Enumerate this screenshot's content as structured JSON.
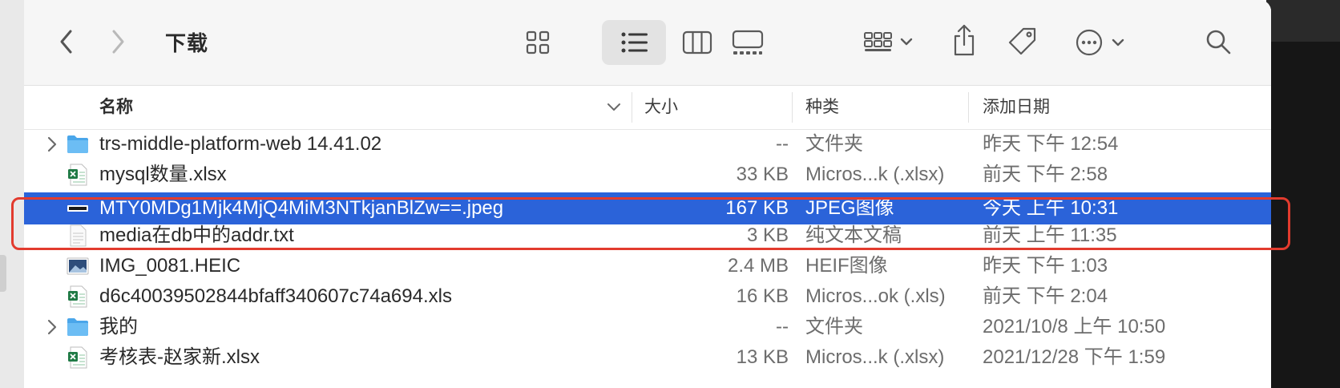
{
  "window": {
    "title": "下载",
    "toolbar_icons": [
      "chevron-left-icon",
      "chevron-right-icon",
      "grid-view-icon",
      "list-view-icon",
      "column-view-icon",
      "gallery-view-icon",
      "group-icon",
      "share-icon",
      "tag-icon",
      "more-icon",
      "search-icon"
    ]
  },
  "columns": {
    "name": "名称",
    "size": "大小",
    "kind": "种类",
    "date_added": "添加日期"
  },
  "files": [
    {
      "name": "trs-middle-platform-web 14.41.02",
      "size": "--",
      "kind": "文件夹",
      "date": "昨天 下午 12:54",
      "icon": "folder-icon",
      "expandable": true,
      "selected": false
    },
    {
      "name": "mysql数量.xlsx",
      "size": "33 KB",
      "kind": "Micros...k (.xlsx)",
      "date": "前天 下午 2:58",
      "icon": "excel-icon",
      "expandable": false,
      "selected": false
    },
    {
      "name": "MTY0MDg1Mjk4MjQ4MiM3NTkjanBlZw==.jpeg",
      "size": "167 KB",
      "kind": "JPEG图像",
      "date": "今天 上午 10:31",
      "icon": "image-icon",
      "expandable": false,
      "selected": true
    },
    {
      "name": "media在db中的addr.txt",
      "size": "3 KB",
      "kind": "纯文本文稿",
      "date": "前天 上午 11:35",
      "icon": "text-file-icon",
      "expandable": false,
      "selected": false
    },
    {
      "name": "IMG_0081.HEIC",
      "size": "2.4 MB",
      "kind": "HEIF图像",
      "date": "昨天 下午 1:03",
      "icon": "photo-icon",
      "expandable": false,
      "selected": false
    },
    {
      "name": "d6c40039502844bfaff340607c74a694.xls",
      "size": "16 KB",
      "kind": "Micros...ok (.xls)",
      "date": "前天 下午 2:04",
      "icon": "excel-icon",
      "expandable": false,
      "selected": false
    },
    {
      "name": "我的",
      "size": "--",
      "kind": "文件夹",
      "date": "2021/10/8 上午 10:50",
      "icon": "folder-icon",
      "expandable": true,
      "selected": false
    },
    {
      "name": "考核表-赵家新.xlsx",
      "size": "13 KB",
      "kind": "Micros...k (.xlsx)",
      "date": "2021/12/28 下午 1:59",
      "icon": "excel-icon",
      "expandable": false,
      "selected": false
    }
  ],
  "colors": {
    "selection": "#2b63d9",
    "annotation": "#e23b2e",
    "folder": "#5ab0ef",
    "excel": "#1f7a45"
  }
}
